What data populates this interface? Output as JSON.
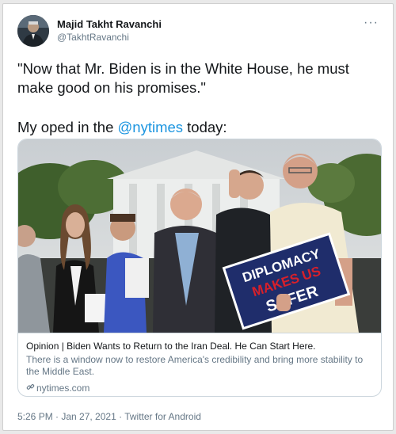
{
  "user": {
    "display_name": "Majid Takht Ravanchi",
    "handle": "@TakhtRavanchi"
  },
  "menu": {
    "more_label": "···"
  },
  "tweet": {
    "quote": "\"Now that Mr. Biden is in the White House, he must make good on his promises.\"",
    "oped_prefix": "My oped in the ",
    "mention": "@nytimes",
    "oped_suffix": " today:"
  },
  "card": {
    "sign_lines": [
      "DIPLOMACY",
      "MAKES US",
      "SAFER"
    ],
    "title": "Opinion | Biden Wants to Return to the Iran Deal. He Can Start Here.",
    "description": "There is a window now to restore America's credibility and bring more stability to the Middle East.",
    "link_icon": "link-icon",
    "domain": "nytimes.com"
  },
  "meta": {
    "timestamp": "5:26 PM · Jan 27, 2021 · Twitter for Android"
  },
  "colors": {
    "mention": "#1b95e0",
    "secondary_text": "#657786",
    "sign_background": "#1f2d6b",
    "sign_red": "#d7202a"
  }
}
